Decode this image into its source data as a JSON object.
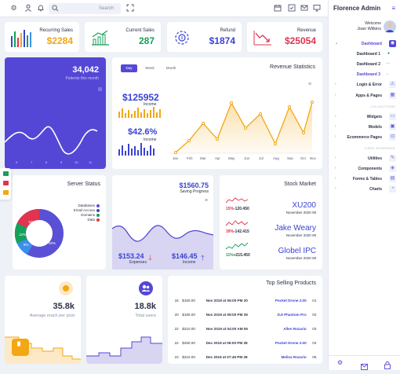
{
  "search": {
    "placeholder": "Search"
  },
  "stats": [
    {
      "label": "Recurring Sales",
      "value": "$2284",
      "color": "#f3a712"
    },
    {
      "label": "Current Sales",
      "value": "287",
      "color": "#16a05a"
    },
    {
      "label": "Refund",
      "value": "$1874",
      "color": "#3b43d3"
    },
    {
      "label": "Revenue",
      "value": "$25054",
      "color": "#e0344f"
    }
  ],
  "patients": {
    "value": "34,042",
    "label": "Patients this month",
    "x_ticks": [
      "5",
      "7",
      "8",
      "9",
      "10",
      "11"
    ]
  },
  "revenue": {
    "title": "Revenue Statistics",
    "tabs": [
      "Day",
      "Week",
      "Month"
    ],
    "income_value": "$125952",
    "income_label": "Income",
    "pct_value": "$42.6%",
    "pct_label": "Income"
  },
  "server": {
    "title": "Server Status",
    "legend": [
      "Databases",
      "Email Accoun",
      "Domains",
      "Data"
    ],
    "slices": [
      {
        "label": "15%",
        "value": 15,
        "color": "#e0344f"
      },
      {
        "label": "12%",
        "value": 12,
        "color": "#16a05a"
      },
      {
        "label": "8%",
        "value": 8,
        "color": "#3b8fe8"
      },
      {
        "label": "50%",
        "value": 50,
        "color": "#5a50d6"
      }
    ]
  },
  "savings": {
    "value": "$1560.75",
    "label": "Saving Progress",
    "expenses_value": "$153.24",
    "expenses_label": "Expenses",
    "income_value": "$146.45",
    "income_label": "Income"
  },
  "stock": {
    "title": "Stock Market",
    "items": [
      {
        "change": "15%",
        "amount": "-120.450",
        "name": "XU200",
        "date": "November 2020 08",
        "color": "#e0344f"
      },
      {
        "change": "39%",
        "amount": "-142.415",
        "name": "Jake Weary",
        "date": "November 2020 08",
        "color": "#e0344f"
      },
      {
        "change": "11%",
        "amount": "+215.450",
        "name": "Globel IPC",
        "date": "November 2020 08",
        "color": "#16a05a"
      }
    ]
  },
  "reach": {
    "value": "35.8k",
    "label": "Average reach per post"
  },
  "users": {
    "value": "18.8k",
    "label": "Total users"
  },
  "products": {
    "title": "Top Selling Products",
    "rows": [
      [
        "16",
        "$150.00",
        "Nov 2019 at 06:00 PM 20",
        "Pocket Drone 2.00",
        "01"
      ],
      [
        "20",
        "$180.00",
        "Nov 2019 at 09:00 PM 29",
        "DJI Phantom Pro",
        "02"
      ],
      [
        "22",
        "$210.00",
        "Nov 2019 at 04:00 AM 06",
        "Allen Rozario",
        "03"
      ],
      [
        "22",
        "$250.00",
        "Dec 2019 at 06:00 PM 28",
        "Pocket Drone 2.00",
        "04"
      ],
      [
        "23",
        "$210.00",
        "Dec 2019 at 07:45 PM 28",
        "Melisa Rozario",
        "05"
      ]
    ]
  },
  "sidebar": {
    "brand": "Florence Admin",
    "welcome": "Welcome",
    "user": "Joan Wilkins",
    "items": [
      {
        "label": "Dashboard",
        "active": true,
        "icon": "eye-icon"
      },
      {
        "label": "Dashboard 1",
        "sub": true
      },
      {
        "label": "Dashboard 2",
        "sub": true
      },
      {
        "label": "Dashboard 3",
        "sub": true
      },
      {
        "label": "Login & Error",
        "icon": "lock-icon"
      },
      {
        "label": "Apps & Pages",
        "icon": "grid-icon"
      }
    ],
    "section1": "COLLECTIONS",
    "items2": [
      {
        "label": "Widgets",
        "icon": "widget-icon"
      },
      {
        "label": "Models",
        "icon": "model-icon"
      },
      {
        "label": "Ecommerce Pages",
        "icon": "cart-icon"
      }
    ],
    "section2": "USER INTERFACE",
    "items3": [
      {
        "label": "Utilities",
        "icon": "layers-icon"
      },
      {
        "label": "Components",
        "icon": "component-icon"
      },
      {
        "label": "Forms & Tables",
        "icon": "form-icon"
      },
      {
        "label": "Charts",
        "icon": "chart-icon"
      }
    ]
  }
}
